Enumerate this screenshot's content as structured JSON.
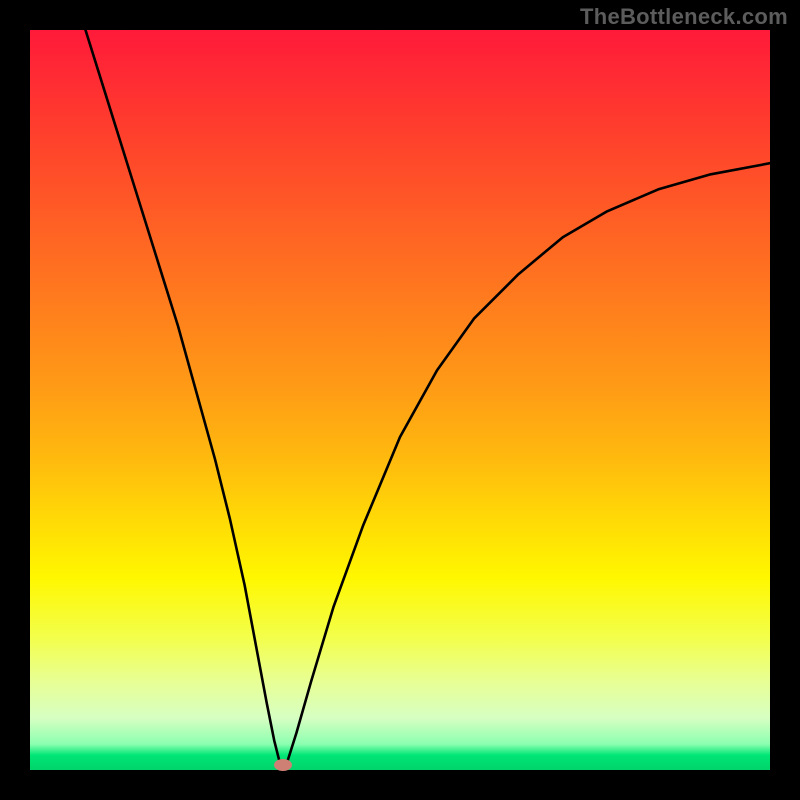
{
  "watermark": "TheBottleneck.com",
  "chart_data": {
    "type": "line",
    "title": "",
    "xlabel": "",
    "ylabel": "",
    "xlim": [
      0,
      100
    ],
    "ylim": [
      0,
      100
    ],
    "grid": false,
    "legend": false,
    "curve_points_pct": [
      [
        7.5,
        100
      ],
      [
        10,
        92
      ],
      [
        12.5,
        84
      ],
      [
        15,
        76
      ],
      [
        17.5,
        68
      ],
      [
        20,
        60
      ],
      [
        22.5,
        51
      ],
      [
        25,
        42
      ],
      [
        27,
        34
      ],
      [
        29,
        25
      ],
      [
        30.5,
        17
      ],
      [
        32,
        9
      ],
      [
        33,
        4
      ],
      [
        33.7,
        1.2
      ],
      [
        34.2,
        0.2
      ],
      [
        34.8,
        1.2
      ],
      [
        36,
        5
      ],
      [
        38,
        12
      ],
      [
        41,
        22
      ],
      [
        45,
        33
      ],
      [
        50,
        45
      ],
      [
        55,
        54
      ],
      [
        60,
        61
      ],
      [
        66,
        67
      ],
      [
        72,
        72
      ],
      [
        78,
        75.5
      ],
      [
        85,
        78.5
      ],
      [
        92,
        80.5
      ],
      [
        100,
        82
      ]
    ],
    "marker_pct": {
      "x": 34.2,
      "y": 0.7
    },
    "gradient_stops": [
      {
        "pct": 0,
        "color": "#ff1a3a"
      },
      {
        "pct": 48,
        "color": "#ff9a16"
      },
      {
        "pct": 74,
        "color": "#fff700"
      },
      {
        "pct": 96.5,
        "color": "#8cffb0"
      },
      {
        "pct": 100,
        "color": "#00d36a"
      }
    ]
  }
}
